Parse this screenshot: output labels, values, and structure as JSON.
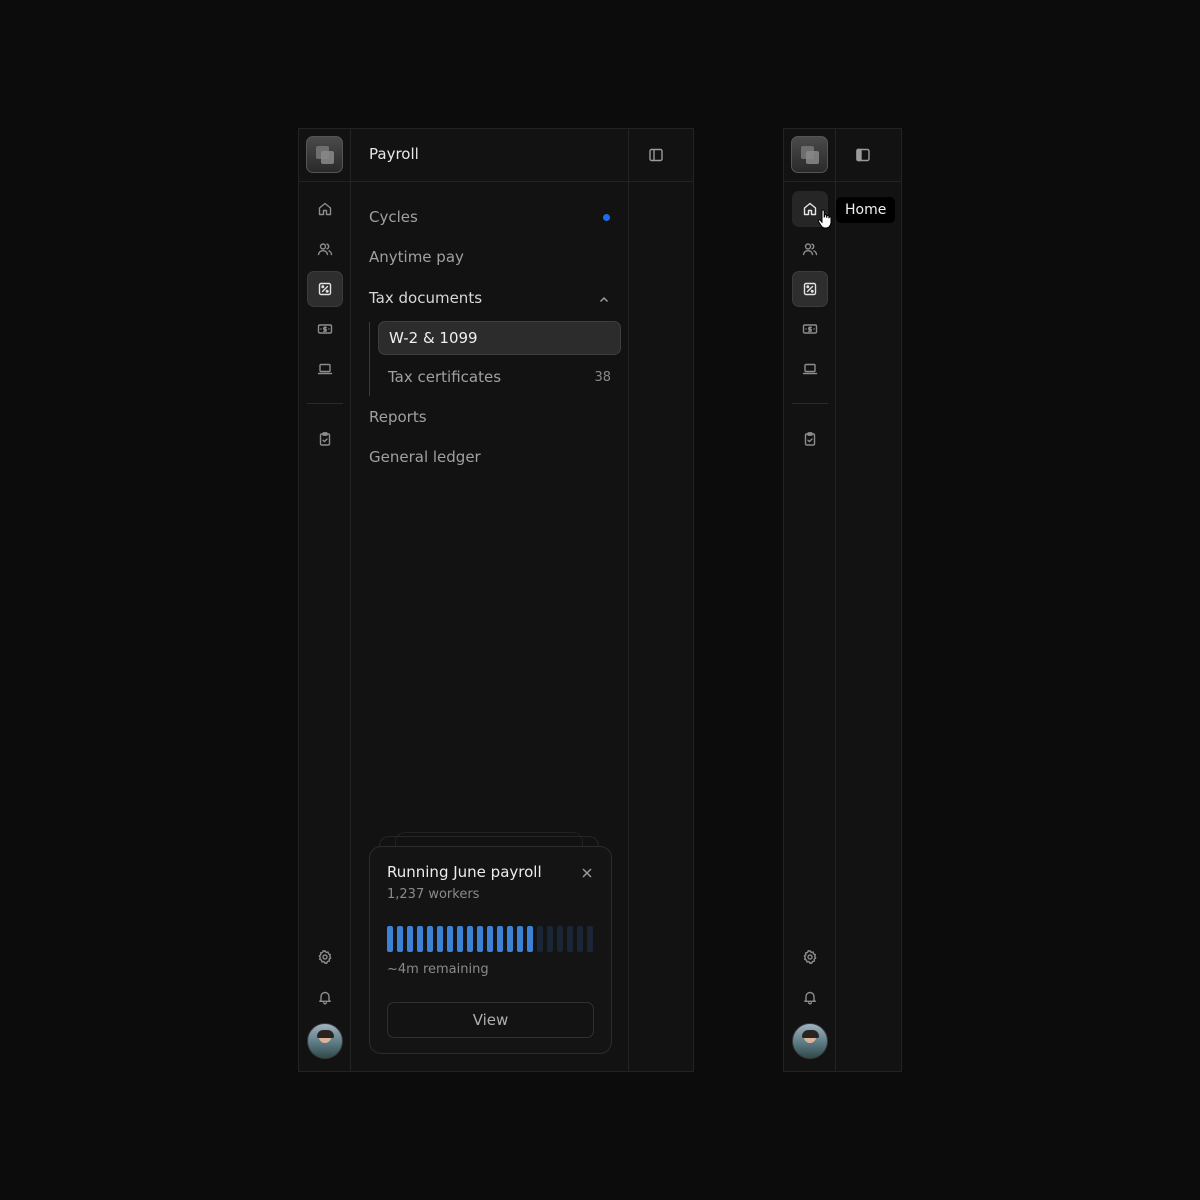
{
  "panel": {
    "title": "Payroll",
    "items": [
      {
        "label": "Cycles",
        "has_dot": true
      },
      {
        "label": "Anytime pay"
      },
      {
        "label": "Tax documents",
        "expanded": true
      },
      {
        "label": "Reports"
      },
      {
        "label": "General ledger"
      }
    ],
    "subitems": [
      {
        "label": "W-2 & 1099",
        "selected": true
      },
      {
        "label": "Tax certificates",
        "count": "38"
      }
    ]
  },
  "rail": {
    "items": [
      {
        "icon": "home-icon"
      },
      {
        "icon": "users-icon"
      },
      {
        "icon": "percent-document-icon",
        "active": true
      },
      {
        "icon": "banknote-icon"
      },
      {
        "icon": "laptop-icon"
      },
      {
        "icon": "clipboard-check-icon"
      }
    ],
    "footer": [
      {
        "icon": "gear-icon"
      },
      {
        "icon": "bell-icon"
      },
      {
        "icon": "avatar"
      }
    ]
  },
  "payroll_card": {
    "title": "Running June payroll",
    "subtitle": "1,237 workers",
    "remaining": "~4m remaining",
    "view_label": "View",
    "progress_segments_filled": 15,
    "progress_segments_total": 21
  },
  "tooltip": {
    "label": "Home"
  },
  "colors": {
    "accent_dot": "#1d6cf0",
    "progress_filled": "#3b82d6",
    "progress_empty": "#1a2636",
    "background": "#0c0c0c",
    "panel": "#121212"
  }
}
